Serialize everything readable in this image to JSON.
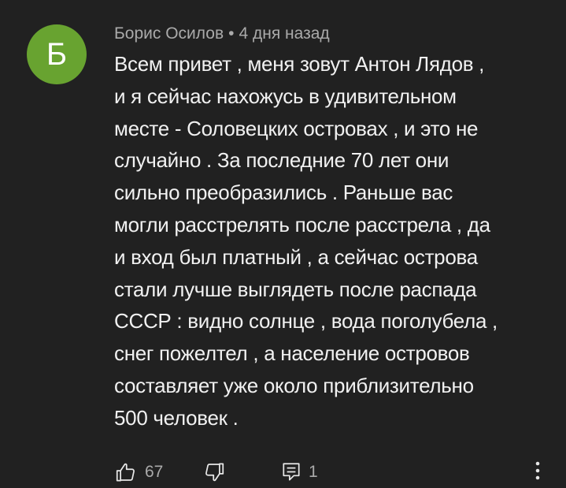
{
  "comment": {
    "avatar_letter": "Б",
    "avatar_color": "#68a330",
    "author": "Борис Осилов",
    "separator": "•",
    "time": "4 дня назад",
    "text": "Всем привет , меня зовут Антон Лядов ,\nи я сейчас нахожусь в удивительном\nместе - Соловецких островах , и это не\nслучайно . За последние 70 лет они\nсильно преобразились . Раньше вас\nмогли расстрелять после расстрела , да\nи вход был платный , а сейчас острова\nстали лучше выглядеть после распада\nСССР : видно солнце , вода поголубела ,\nснег пожелтел , а  население островов\nсоставляет уже около приблизительно\n500 человек ."
  },
  "actions": {
    "like_icon": "thumb-up-icon",
    "like_count": "67",
    "dislike_icon": "thumb-down-icon",
    "reply_icon": "reply-icon",
    "reply_count": "1",
    "more_icon": "more-vertical-icon"
  },
  "colors": {
    "background": "#212121",
    "text": "#f1f1f1",
    "secondary_text": "#aaaaaa"
  }
}
